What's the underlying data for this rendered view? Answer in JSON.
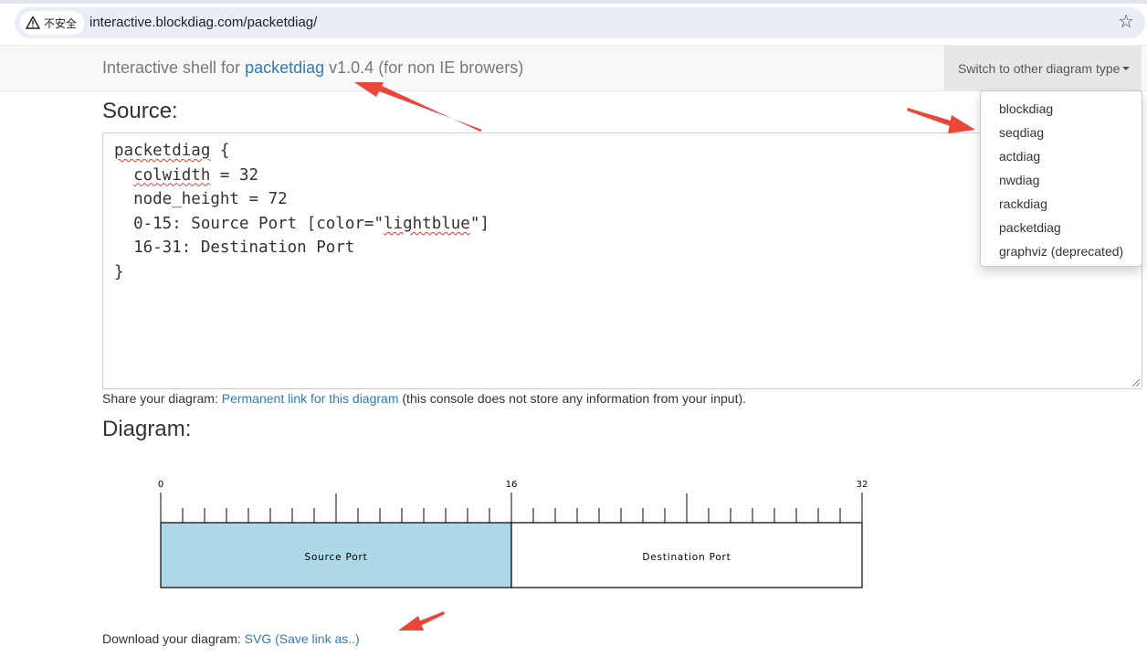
{
  "browser": {
    "security_label": "不安全",
    "url": "interactive.blockdiag.com/packetdiag/"
  },
  "navbar": {
    "brand_prefix": "Interactive shell for ",
    "brand_link": "packetdiag",
    "brand_suffix": " v1.0.4 (for non IE browers)",
    "switch_label": "Switch to other diagram type",
    "dropdown_items": [
      "blockdiag",
      "seqdiag",
      "actdiag",
      "nwdiag",
      "rackdiag",
      "packetdiag",
      "graphviz (deprecated)"
    ]
  },
  "source": {
    "heading": "Source:",
    "lines": [
      "packetdiag {",
      "  colwidth = 32",
      "  node_height = 72",
      "  0-15: Source Port [color=\"lightblue\"]",
      "  16-31: Destination Port",
      "}"
    ]
  },
  "share": {
    "prefix": "Share your diagram: ",
    "link": "Permanent link for this diagram",
    "suffix": " (this console does not store any information from your input)."
  },
  "diagram": {
    "heading": "Diagram:",
    "scale_labels": [
      "0",
      "16",
      "32"
    ],
    "fields": [
      {
        "label": "Source Port",
        "start": 0,
        "end": 15,
        "color": "#add8e6"
      },
      {
        "label": "Destination Port",
        "start": 16,
        "end": 31,
        "color": "#ffffff"
      }
    ]
  },
  "download": {
    "prefix": "Download your diagram: ",
    "link": "SVG (Save link as..)"
  },
  "colors": {
    "link": "#337ab7",
    "annotation_arrow": "#e8473a",
    "navbar_bg": "#f8f8f8"
  }
}
